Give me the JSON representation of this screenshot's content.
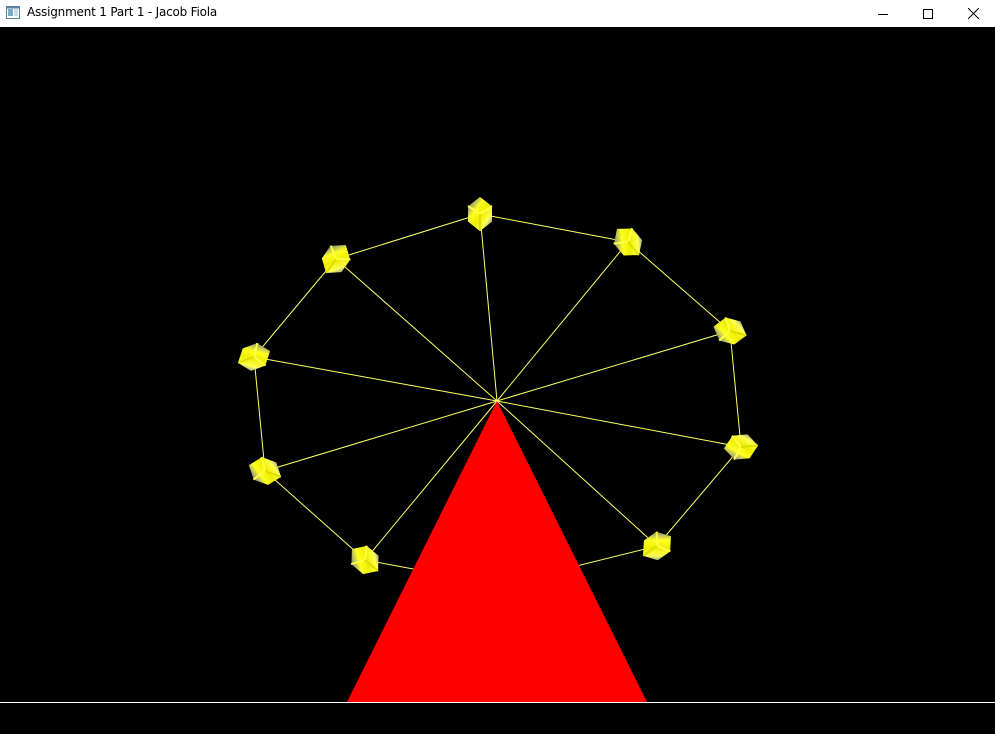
{
  "window": {
    "title": "Assignment 1 Part 1 - Jacob Fiola",
    "app_icon": "window-app-icon",
    "controls": {
      "minimize": "minimize-icon",
      "maximize": "maximize-icon",
      "close": "close-icon"
    }
  },
  "scene": {
    "background_color": "#000000",
    "ground_line_color": "#ffffff",
    "stand_color": "#ff0000",
    "spoke_color": "#ffff66",
    "rim_color": "#ffff66",
    "gondola_colors": [
      "#ffff00",
      "#3333cc"
    ],
    "gondola_count": 10
  }
}
